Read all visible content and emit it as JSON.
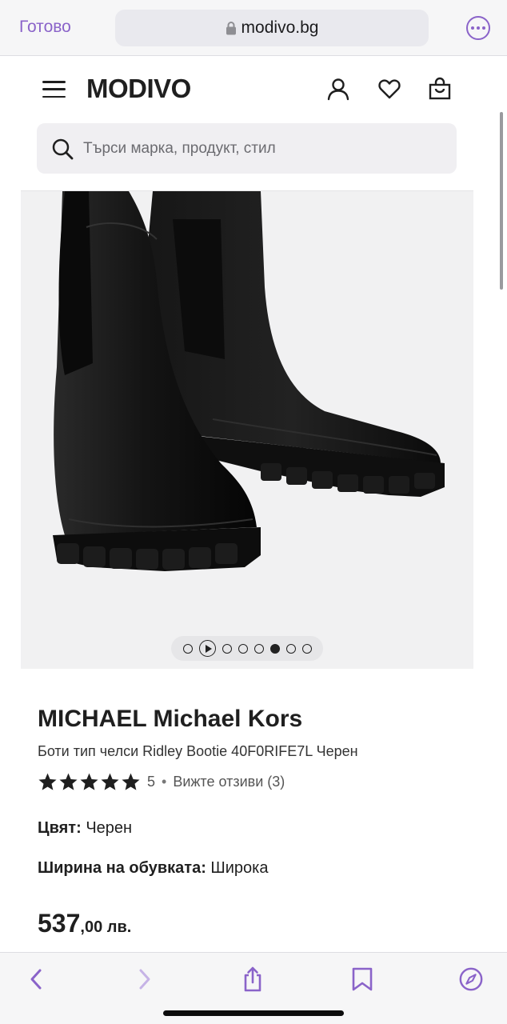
{
  "browser": {
    "done_label": "Готово",
    "url": "modivo.bg",
    "accent_color": "#8a63c9"
  },
  "header": {
    "logo": "MODIVO",
    "icons": [
      "menu-icon",
      "user-icon",
      "heart-icon",
      "bag-icon"
    ]
  },
  "search": {
    "placeholder": "Търси марка, продукт, стил",
    "value": ""
  },
  "gallery": {
    "image_description_icon": "product-photo",
    "dot_count": 7,
    "active_dot_index": 4
  },
  "product": {
    "brand": "MICHAEL Michael Kors",
    "name": "Боти тип челси Ridley Bootie 40F0RIFE7L Черен",
    "rating": {
      "stars": 5,
      "value": "5",
      "separator": "•",
      "reviews_link": "Вижте отзиви (3)"
    },
    "color": {
      "label": "Цвят:",
      "value": "Черен"
    },
    "width": {
      "label": "Ширина на обувката:",
      "value": "Широка"
    },
    "price": {
      "main": "537",
      "fraction": ",00 лв."
    }
  }
}
